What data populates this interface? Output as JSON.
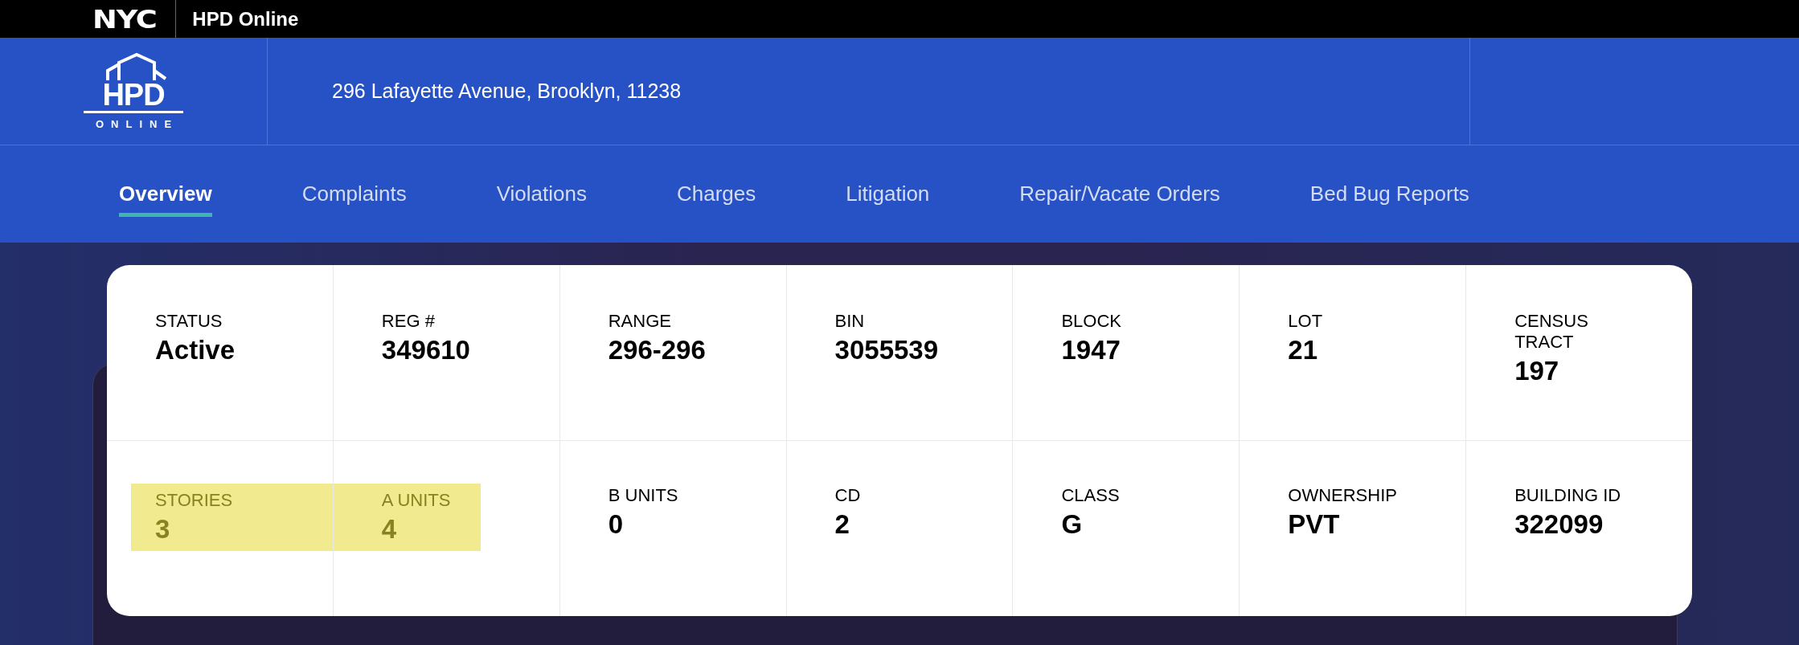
{
  "top_bar": {
    "logo": "NYC",
    "title": "HPD Online"
  },
  "header": {
    "logo_text": "HPD",
    "logo_subtext": "ONLINE",
    "address": "296 Lafayette Avenue, Brooklyn, 11238"
  },
  "tabs": [
    {
      "label": "Overview",
      "selected": true
    },
    {
      "label": "Complaints",
      "selected": false
    },
    {
      "label": "Violations",
      "selected": false
    },
    {
      "label": "Charges",
      "selected": false
    },
    {
      "label": "Litigation",
      "selected": false
    },
    {
      "label": "Repair/Vacate Orders",
      "selected": false
    },
    {
      "label": "Bed Bug Reports",
      "selected": false
    }
  ],
  "summary": {
    "rows": [
      [
        {
          "label": "STATUS",
          "value": "Active",
          "highlighted": false
        },
        {
          "label": "REG #",
          "value": "349610",
          "highlighted": false
        },
        {
          "label": "RANGE",
          "value": "296-296",
          "highlighted": false
        },
        {
          "label": "BIN",
          "value": "3055539",
          "highlighted": false
        },
        {
          "label": "BLOCK",
          "value": "1947",
          "highlighted": false
        },
        {
          "label": "LOT",
          "value": "21",
          "highlighted": false
        },
        {
          "label": "CENSUS TRACT",
          "value": "197",
          "highlighted": false
        }
      ],
      [
        {
          "label": "STORIES",
          "value": "3",
          "highlighted": true
        },
        {
          "label": "A UNITS",
          "value": "4",
          "highlighted": true
        },
        {
          "label": "B UNITS",
          "value": "0",
          "highlighted": false
        },
        {
          "label": "CD",
          "value": "2",
          "highlighted": false
        },
        {
          "label": "CLASS",
          "value": "G",
          "highlighted": false
        },
        {
          "label": "OWNERSHIP",
          "value": "PVT",
          "highlighted": false
        },
        {
          "label": "BUILDING ID",
          "value": "322099",
          "highlighted": false
        }
      ]
    ]
  }
}
